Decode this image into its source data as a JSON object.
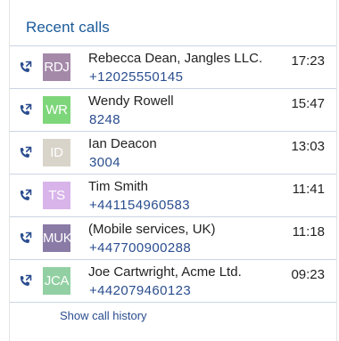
{
  "panel": {
    "title": "Recent calls",
    "history_link": "Show call history"
  },
  "calls": [
    {
      "initials": "RDJ",
      "avatar_color": "#a489a9",
      "name": "Rebecca Dean, Jangles LLC.",
      "number": "+12025550145",
      "time": "17:23",
      "icon": "outgoing-call-icon"
    },
    {
      "initials": "WR",
      "avatar_color": "#7ed67a",
      "name": "Wendy Rowell",
      "number": "8248",
      "time": "15:47",
      "icon": "outgoing-call-icon"
    },
    {
      "initials": "ID",
      "avatar_color": "#d9d4c9",
      "name": "Ian Deacon",
      "number": "3004",
      "time": "13:03",
      "icon": "outgoing-call-icon"
    },
    {
      "initials": "TS",
      "avatar_color": "#d8b4ea",
      "name": "Tim Smith",
      "number": "+441154960583",
      "time": "11:41",
      "icon": "outgoing-call-icon"
    },
    {
      "initials": "MUK",
      "avatar_color": "#8a7aa6",
      "name": "(Mobile services, UK)",
      "number": "+447700900288",
      "time": "11:18",
      "icon": "outgoing-call-icon"
    },
    {
      "initials": "JCA",
      "avatar_color": "#92d0a3",
      "name": "Joe Cartwright, Acme Ltd.",
      "number": "+442079460123",
      "time": "09:23",
      "icon": "outgoing-call-icon"
    }
  ],
  "colors": {
    "accent": "#1a5a99",
    "link": "#2a4d8f",
    "divider": "#c9d6e4"
  }
}
